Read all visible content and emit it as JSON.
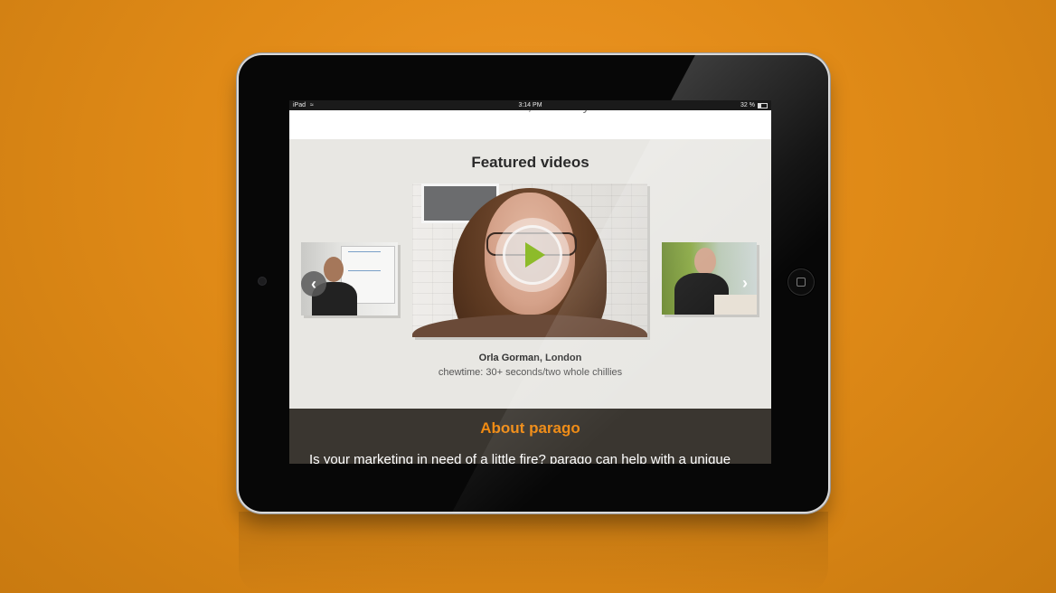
{
  "status_bar": {
    "device": "iPad",
    "time": "3:14 PM",
    "battery": "32 %",
    "battery_level": 0.32,
    "wifi_icon": "wifi-icon"
  },
  "intro_text": "on our Wall of Flame, and tell your friends.",
  "featured": {
    "title": "Featured videos",
    "prev_arrow": "‹",
    "next_arrow": "›",
    "videos": [
      {
        "position": "left",
        "name": ""
      },
      {
        "position": "main",
        "name": "Orla Gorman, London",
        "chewtime": "chewtime: 30+ seconds/two whole chillies"
      },
      {
        "position": "right",
        "name": ""
      }
    ]
  },
  "about": {
    "title": "About parago",
    "text": "Is your marketing in need of a little fire? parago can help with a unique"
  },
  "colors": {
    "background": "#e08a17",
    "accent": "#ef8a12",
    "play_button": "#8dbb2a",
    "about_bg": "#3a3630"
  }
}
